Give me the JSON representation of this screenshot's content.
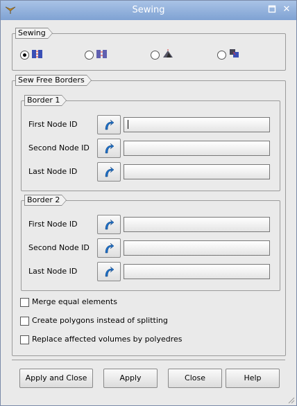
{
  "window": {
    "title": "Sewing"
  },
  "sewing_group": {
    "label": "Sewing",
    "modes": [
      {
        "icon": "sew-free-borders-icon",
        "selected": true
      },
      {
        "icon": "sew-conform-free-borders-icon",
        "selected": false
      },
      {
        "icon": "sew-border-to-side-icon",
        "selected": false
      },
      {
        "icon": "sew-side-elements-icon",
        "selected": false
      }
    ]
  },
  "sew_free_borders": {
    "label": "Sew Free Borders",
    "border1": {
      "label": "Border 1",
      "first_node_label": "First Node ID",
      "second_node_label": "Second Node ID",
      "last_node_label": "Last Node ID",
      "first_node_value": "",
      "second_node_value": "",
      "last_node_value": ""
    },
    "border2": {
      "label": "Border 2",
      "first_node_label": "First Node ID",
      "second_node_label": "Second Node ID",
      "last_node_label": "Last Node ID",
      "first_node_value": "",
      "second_node_value": "",
      "last_node_value": ""
    },
    "options": {
      "merge_equal": "Merge equal elements",
      "create_polygons": "Create polygons instead of splitting",
      "replace_volumes": "Replace affected volumes by polyedres"
    }
  },
  "buttons": {
    "apply_close": "Apply and Close",
    "apply": "Apply",
    "close": "Close",
    "help": "Help"
  },
  "colors": {
    "titlebar": "#8fb0dc",
    "select_arrow": "#1f6fc4"
  }
}
